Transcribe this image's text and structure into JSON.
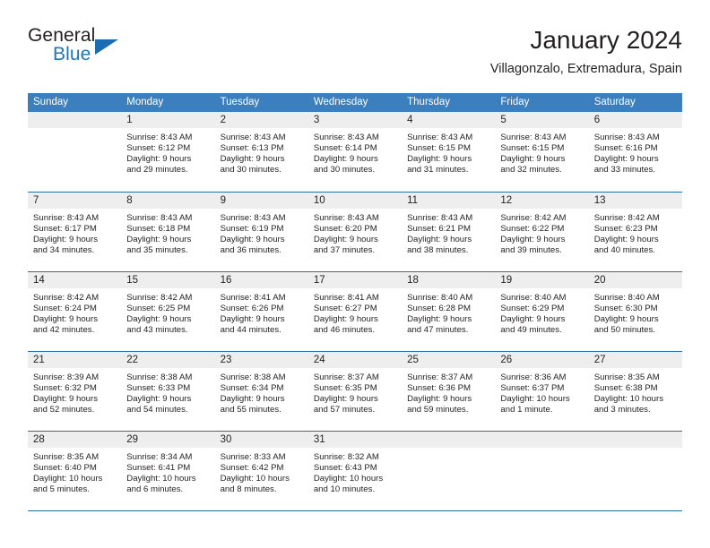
{
  "brand": {
    "word_general": "General",
    "word_blue": "Blue",
    "accent_color": "#1b76bc",
    "triangle_color": "#1b6cb0"
  },
  "header": {
    "title": "January 2024",
    "location": "Villagonzalo, Extremadura, Spain"
  },
  "calendar": {
    "header_bg": "#3c7fbf",
    "row_divider_color": "#2e6da4",
    "daynum_band_bg": "#eeeeee",
    "weekdays": [
      "Sunday",
      "Monday",
      "Tuesday",
      "Wednesday",
      "Thursday",
      "Friday",
      "Saturday"
    ],
    "weeks": [
      [
        {
          "day": "",
          "sunrise": "",
          "sunset": "",
          "daylight_line1": "",
          "daylight_line2": ""
        },
        {
          "day": "1",
          "sunrise": "Sunrise: 8:43 AM",
          "sunset": "Sunset: 6:12 PM",
          "daylight_line1": "Daylight: 9 hours",
          "daylight_line2": "and 29 minutes."
        },
        {
          "day": "2",
          "sunrise": "Sunrise: 8:43 AM",
          "sunset": "Sunset: 6:13 PM",
          "daylight_line1": "Daylight: 9 hours",
          "daylight_line2": "and 30 minutes."
        },
        {
          "day": "3",
          "sunrise": "Sunrise: 8:43 AM",
          "sunset": "Sunset: 6:14 PM",
          "daylight_line1": "Daylight: 9 hours",
          "daylight_line2": "and 30 minutes."
        },
        {
          "day": "4",
          "sunrise": "Sunrise: 8:43 AM",
          "sunset": "Sunset: 6:15 PM",
          "daylight_line1": "Daylight: 9 hours",
          "daylight_line2": "and 31 minutes."
        },
        {
          "day": "5",
          "sunrise": "Sunrise: 8:43 AM",
          "sunset": "Sunset: 6:15 PM",
          "daylight_line1": "Daylight: 9 hours",
          "daylight_line2": "and 32 minutes."
        },
        {
          "day": "6",
          "sunrise": "Sunrise: 8:43 AM",
          "sunset": "Sunset: 6:16 PM",
          "daylight_line1": "Daylight: 9 hours",
          "daylight_line2": "and 33 minutes."
        }
      ],
      [
        {
          "day": "7",
          "sunrise": "Sunrise: 8:43 AM",
          "sunset": "Sunset: 6:17 PM",
          "daylight_line1": "Daylight: 9 hours",
          "daylight_line2": "and 34 minutes."
        },
        {
          "day": "8",
          "sunrise": "Sunrise: 8:43 AM",
          "sunset": "Sunset: 6:18 PM",
          "daylight_line1": "Daylight: 9 hours",
          "daylight_line2": "and 35 minutes."
        },
        {
          "day": "9",
          "sunrise": "Sunrise: 8:43 AM",
          "sunset": "Sunset: 6:19 PM",
          "daylight_line1": "Daylight: 9 hours",
          "daylight_line2": "and 36 minutes."
        },
        {
          "day": "10",
          "sunrise": "Sunrise: 8:43 AM",
          "sunset": "Sunset: 6:20 PM",
          "daylight_line1": "Daylight: 9 hours",
          "daylight_line2": "and 37 minutes."
        },
        {
          "day": "11",
          "sunrise": "Sunrise: 8:43 AM",
          "sunset": "Sunset: 6:21 PM",
          "daylight_line1": "Daylight: 9 hours",
          "daylight_line2": "and 38 minutes."
        },
        {
          "day": "12",
          "sunrise": "Sunrise: 8:42 AM",
          "sunset": "Sunset: 6:22 PM",
          "daylight_line1": "Daylight: 9 hours",
          "daylight_line2": "and 39 minutes."
        },
        {
          "day": "13",
          "sunrise": "Sunrise: 8:42 AM",
          "sunset": "Sunset: 6:23 PM",
          "daylight_line1": "Daylight: 9 hours",
          "daylight_line2": "and 40 minutes."
        }
      ],
      [
        {
          "day": "14",
          "sunrise": "Sunrise: 8:42 AM",
          "sunset": "Sunset: 6:24 PM",
          "daylight_line1": "Daylight: 9 hours",
          "daylight_line2": "and 42 minutes."
        },
        {
          "day": "15",
          "sunrise": "Sunrise: 8:42 AM",
          "sunset": "Sunset: 6:25 PM",
          "daylight_line1": "Daylight: 9 hours",
          "daylight_line2": "and 43 minutes."
        },
        {
          "day": "16",
          "sunrise": "Sunrise: 8:41 AM",
          "sunset": "Sunset: 6:26 PM",
          "daylight_line1": "Daylight: 9 hours",
          "daylight_line2": "and 44 minutes."
        },
        {
          "day": "17",
          "sunrise": "Sunrise: 8:41 AM",
          "sunset": "Sunset: 6:27 PM",
          "daylight_line1": "Daylight: 9 hours",
          "daylight_line2": "and 46 minutes."
        },
        {
          "day": "18",
          "sunrise": "Sunrise: 8:40 AM",
          "sunset": "Sunset: 6:28 PM",
          "daylight_line1": "Daylight: 9 hours",
          "daylight_line2": "and 47 minutes."
        },
        {
          "day": "19",
          "sunrise": "Sunrise: 8:40 AM",
          "sunset": "Sunset: 6:29 PM",
          "daylight_line1": "Daylight: 9 hours",
          "daylight_line2": "and 49 minutes."
        },
        {
          "day": "20",
          "sunrise": "Sunrise: 8:40 AM",
          "sunset": "Sunset: 6:30 PM",
          "daylight_line1": "Daylight: 9 hours",
          "daylight_line2": "and 50 minutes."
        }
      ],
      [
        {
          "day": "21",
          "sunrise": "Sunrise: 8:39 AM",
          "sunset": "Sunset: 6:32 PM",
          "daylight_line1": "Daylight: 9 hours",
          "daylight_line2": "and 52 minutes."
        },
        {
          "day": "22",
          "sunrise": "Sunrise: 8:38 AM",
          "sunset": "Sunset: 6:33 PM",
          "daylight_line1": "Daylight: 9 hours",
          "daylight_line2": "and 54 minutes."
        },
        {
          "day": "23",
          "sunrise": "Sunrise: 8:38 AM",
          "sunset": "Sunset: 6:34 PM",
          "daylight_line1": "Daylight: 9 hours",
          "daylight_line2": "and 55 minutes."
        },
        {
          "day": "24",
          "sunrise": "Sunrise: 8:37 AM",
          "sunset": "Sunset: 6:35 PM",
          "daylight_line1": "Daylight: 9 hours",
          "daylight_line2": "and 57 minutes."
        },
        {
          "day": "25",
          "sunrise": "Sunrise: 8:37 AM",
          "sunset": "Sunset: 6:36 PM",
          "daylight_line1": "Daylight: 9 hours",
          "daylight_line2": "and 59 minutes."
        },
        {
          "day": "26",
          "sunrise": "Sunrise: 8:36 AM",
          "sunset": "Sunset: 6:37 PM",
          "daylight_line1": "Daylight: 10 hours",
          "daylight_line2": "and 1 minute."
        },
        {
          "day": "27",
          "sunrise": "Sunrise: 8:35 AM",
          "sunset": "Sunset: 6:38 PM",
          "daylight_line1": "Daylight: 10 hours",
          "daylight_line2": "and 3 minutes."
        }
      ],
      [
        {
          "day": "28",
          "sunrise": "Sunrise: 8:35 AM",
          "sunset": "Sunset: 6:40 PM",
          "daylight_line1": "Daylight: 10 hours",
          "daylight_line2": "and 5 minutes."
        },
        {
          "day": "29",
          "sunrise": "Sunrise: 8:34 AM",
          "sunset": "Sunset: 6:41 PM",
          "daylight_line1": "Daylight: 10 hours",
          "daylight_line2": "and 6 minutes."
        },
        {
          "day": "30",
          "sunrise": "Sunrise: 8:33 AM",
          "sunset": "Sunset: 6:42 PM",
          "daylight_line1": "Daylight: 10 hours",
          "daylight_line2": "and 8 minutes."
        },
        {
          "day": "31",
          "sunrise": "Sunrise: 8:32 AM",
          "sunset": "Sunset: 6:43 PM",
          "daylight_line1": "Daylight: 10 hours",
          "daylight_line2": "and 10 minutes."
        },
        {
          "day": "",
          "sunrise": "",
          "sunset": "",
          "daylight_line1": "",
          "daylight_line2": ""
        },
        {
          "day": "",
          "sunrise": "",
          "sunset": "",
          "daylight_line1": "",
          "daylight_line2": ""
        },
        {
          "day": "",
          "sunrise": "",
          "sunset": "",
          "daylight_line1": "",
          "daylight_line2": ""
        }
      ]
    ]
  }
}
